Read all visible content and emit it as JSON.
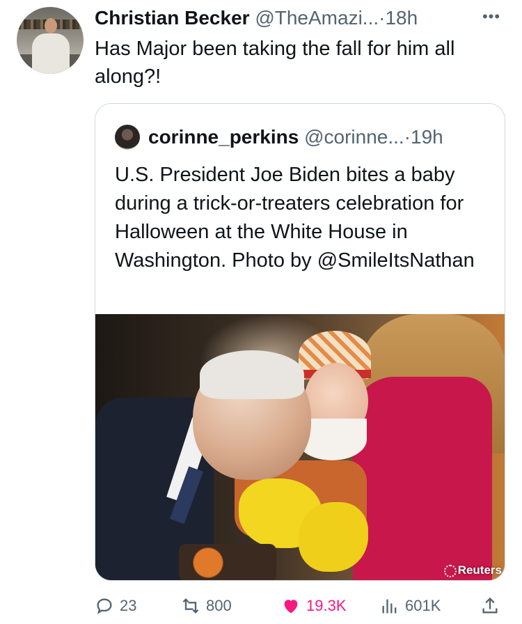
{
  "tweet": {
    "display_name": "Christian Becker",
    "handle": "@TheAmazi...",
    "separator": "·",
    "time": "18h",
    "text": "Has Major been taking the fall for him all along?!"
  },
  "quoted_tweet": {
    "display_name": "corinne_perkins",
    "handle": "@corinne...",
    "separator": "·",
    "time": "19h",
    "text": "U.S. President Joe Biden bites a baby during a trick-or-treaters celebration for Halloween at the White House in Washington. Photo by @SmileItsNathan",
    "photo_credit": "Reuters"
  },
  "actions": {
    "replies": "23",
    "retweets": "800",
    "likes": "19.3K",
    "views": "601K"
  },
  "icons": {
    "more": "more-icon",
    "reply": "reply-icon",
    "retweet": "retweet-icon",
    "like": "heart-icon",
    "views": "views-icon",
    "share": "share-icon"
  },
  "colors": {
    "text": "#0f1419",
    "secondary": "#536471",
    "like": "#f91880",
    "border": "#cfd9de"
  }
}
